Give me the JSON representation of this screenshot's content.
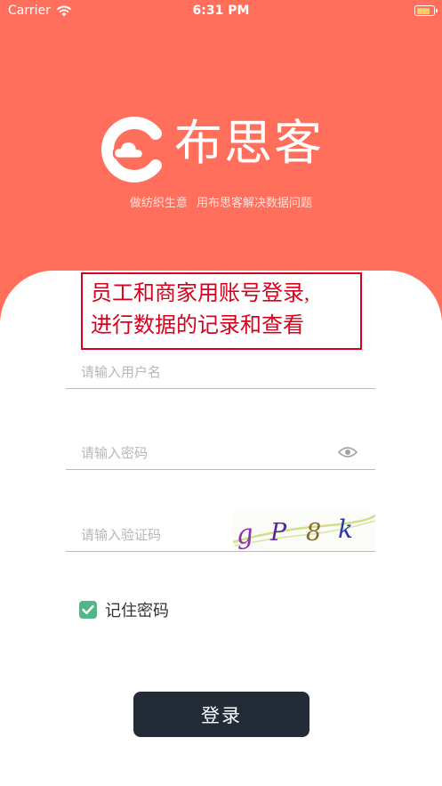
{
  "status_bar": {
    "carrier": "Carrier",
    "time": "6:31 PM",
    "icons": [
      "wifi-icon",
      "battery-icon"
    ]
  },
  "brand": {
    "name": "布思客",
    "slogan": "做纺织生意 用布思客解决数据问题"
  },
  "annotation": {
    "line1": "员工和商家用账号登录,",
    "line2": "进行数据的记录和查看"
  },
  "form": {
    "username_placeholder": "请输入用户名",
    "password_placeholder": "请输入密码",
    "captcha_placeholder": "请输入验证码",
    "captcha_text": "gP8k",
    "remember_label": "记住密码",
    "remember_checked": true,
    "login_label": "登录"
  },
  "colors": {
    "header_bg": "#ff6f5c",
    "annotation_red": "#d7001d",
    "checkbox_green": "#52b788",
    "button_dark": "#222b36"
  }
}
